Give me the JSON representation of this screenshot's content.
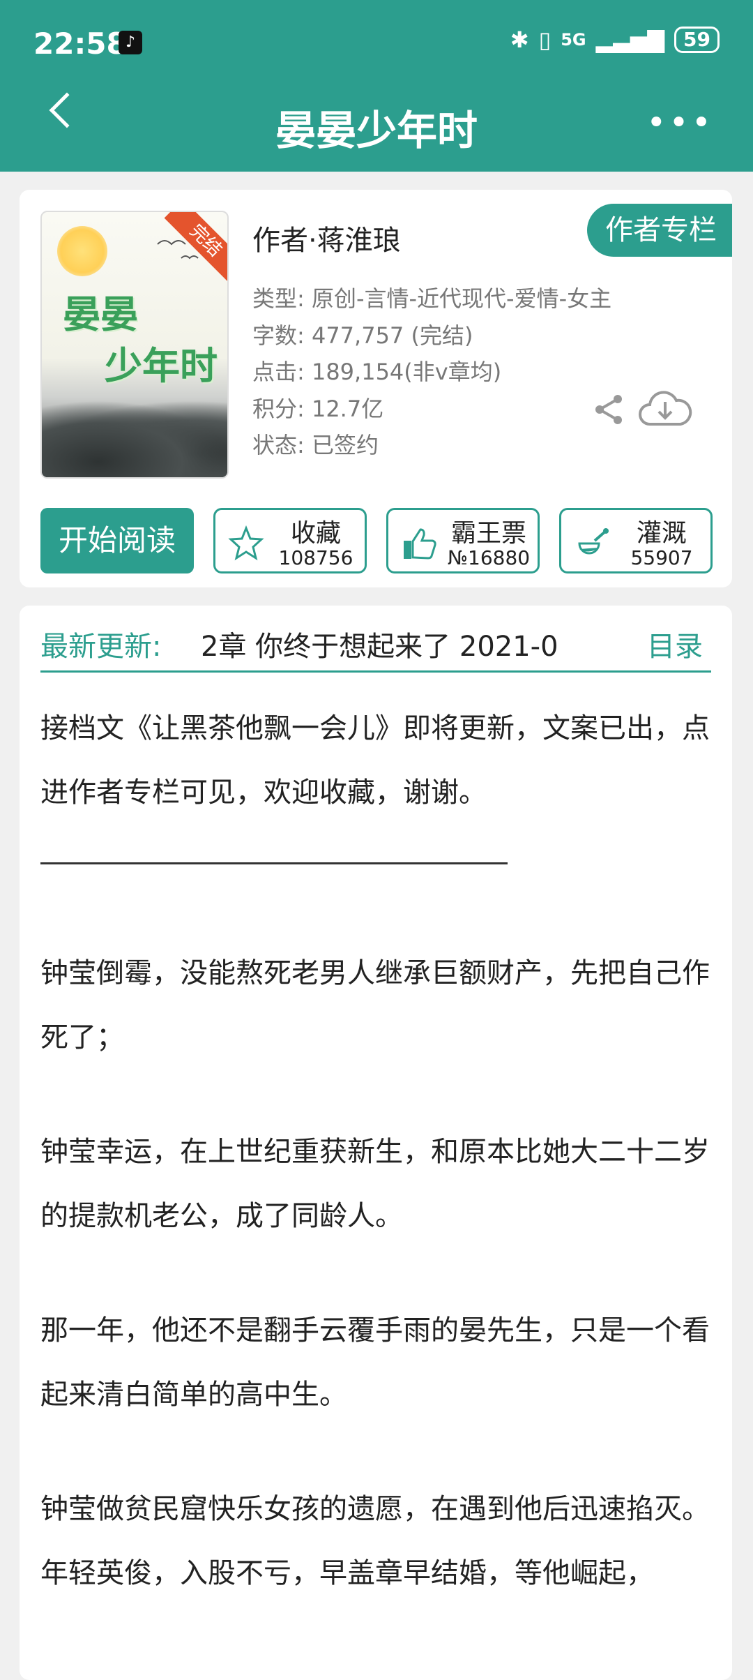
{
  "status_bar": {
    "time": "22:58",
    "network": "5G",
    "battery": "59",
    "icons": [
      "tiktok-icon",
      "bluetooth-icon",
      "vibrate-icon",
      "signal-icon",
      "battery-icon"
    ]
  },
  "header": {
    "title": "晏晏少年时",
    "back_icon": "chevron-left-icon",
    "more_label": "•••"
  },
  "book": {
    "cover_title_line1": "晏晏",
    "cover_title_line2": "少年时",
    "badge": "完结",
    "author": "作者·蒋淮琅",
    "author_column_label": "作者专栏",
    "meta": [
      "类型: 原创-言情-近代现代-爱情-女主",
      "字数: 477,757 (完结)",
      "点击: 189,154(非v章均)",
      "积分: 12.7亿",
      "状态: 已签约"
    ],
    "start_read_label": "开始阅读",
    "actions": [
      {
        "label": "收藏",
        "value": "108756",
        "icon": "star-icon"
      },
      {
        "label": "霸王票",
        "value": "№16880",
        "icon": "thumbs-up-icon"
      },
      {
        "label": "灌溉",
        "value": "55907",
        "icon": "watering-can-icon"
      }
    ]
  },
  "update": {
    "label": "最新更新:",
    "title": "2章  你终于想起来了  2021-0",
    "toc_label": "目录"
  },
  "content": {
    "p1": "接档文《让黑茶他飘一会儿》即将更新，文案已出，点进作者专栏可见，欢迎收藏，谢谢。",
    "p2": "钟莹倒霉，没能熬死老男人继承巨额财产，先把自己作死了；",
    "p3": "钟莹幸运，在上世纪重获新生，和原本比她大二十二岁的提款机老公，成了同龄人。",
    "p4": "那一年，他还不是翻手云覆手雨的晏先生，只是一个看起来清白简单的高中生。",
    "p5": "钟莹做贫民窟快乐女孩的遗愿，在遇到他后迅速掐灭。年轻英俊，入股不亏，早盖章早结婚，等他崛起，"
  },
  "colors": {
    "accent": "#2c9e8e",
    "badge": "#e4542d"
  }
}
